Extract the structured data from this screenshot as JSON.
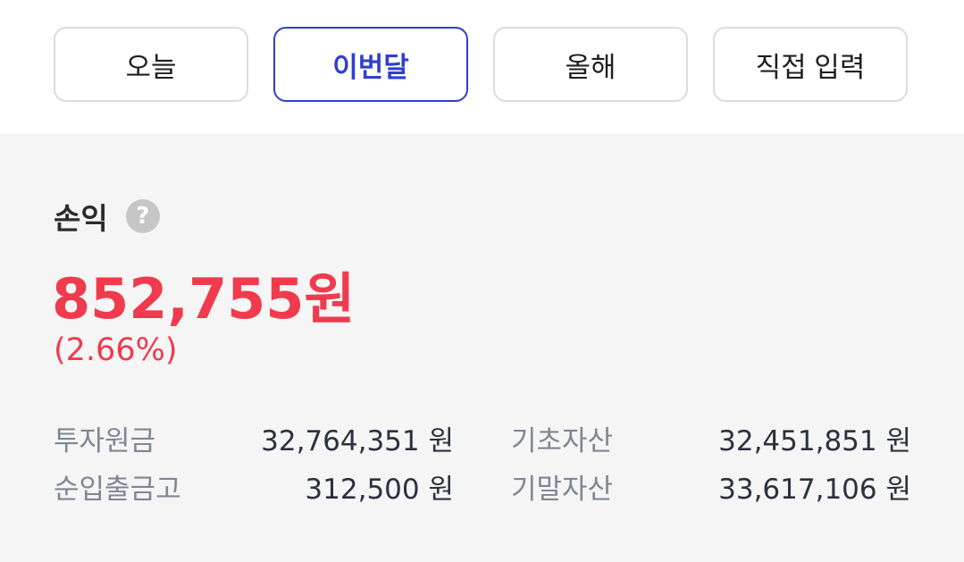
{
  "tabs": [
    {
      "label": "오늘"
    },
    {
      "label": "이번달"
    },
    {
      "label": "올해"
    },
    {
      "label": "직접 입력"
    }
  ],
  "summary": {
    "title": "손익",
    "help_icon": "?",
    "amount": "852,755원",
    "percent": "(2.66%)",
    "accent_color": "#f03a4d"
  },
  "stats": {
    "investment_principal_label": "투자원금",
    "investment_principal_value": "32,764,351 원",
    "net_flow_label": "순입출금고",
    "net_flow_value": "312,500 원",
    "beginning_assets_label": "기초자산",
    "beginning_assets_value": "32,451,851 원",
    "ending_assets_label": "기말자산",
    "ending_assets_value": "33,617,106 원"
  }
}
